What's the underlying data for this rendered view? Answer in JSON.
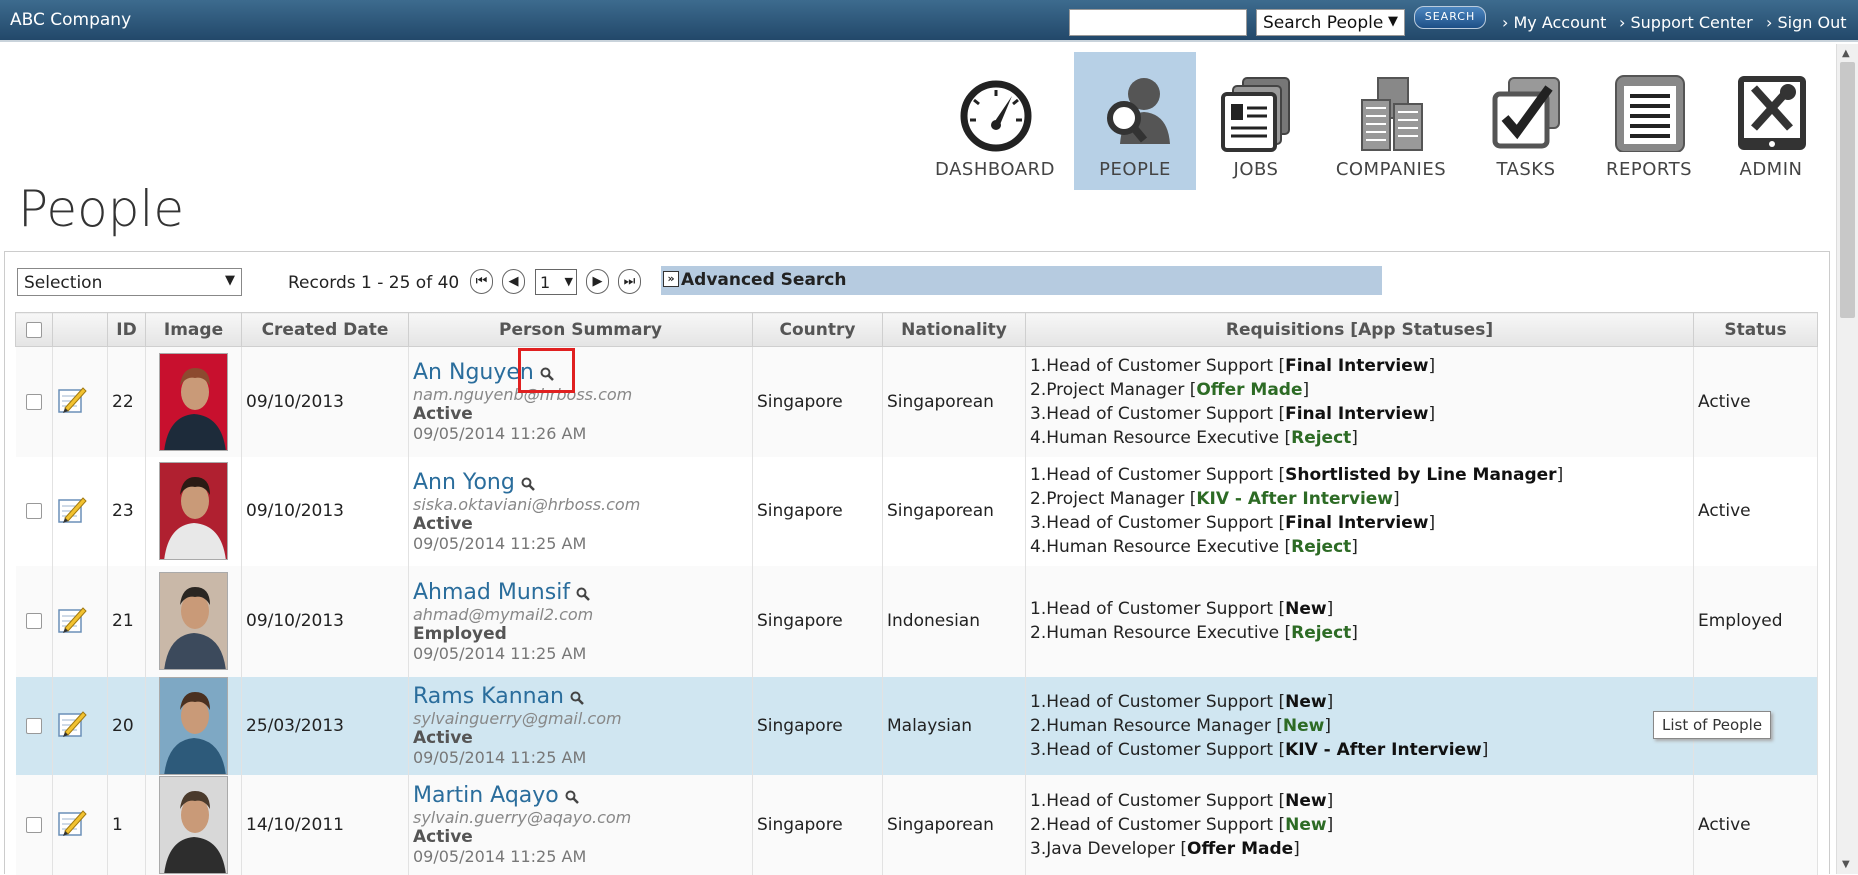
{
  "app": {
    "title": "ABC Company"
  },
  "topbar": {
    "search_placeholder": "",
    "search_type": "Search People",
    "search_button": "SEARCH",
    "links": [
      "› My Account",
      "› Support Center",
      "› Sign Out"
    ]
  },
  "nav": [
    {
      "label": "DASHBOARD",
      "icon": "dashboard-gauge-icon"
    },
    {
      "label": "PEOPLE",
      "icon": "people-icon",
      "active": true
    },
    {
      "label": "JOBS",
      "icon": "jobs-id-cards-icon"
    },
    {
      "label": "COMPANIES",
      "icon": "companies-buildings-icon"
    },
    {
      "label": "TASKS",
      "icon": "tasks-checkbox-icon"
    },
    {
      "label": "REPORTS",
      "icon": "reports-document-icon"
    },
    {
      "label": "ADMIN",
      "icon": "admin-tools-icon"
    }
  ],
  "page": {
    "title": "People"
  },
  "toolbar": {
    "selection": "Selection",
    "records": "Records 1 - 25 of 40",
    "page_number": "1",
    "advanced_search": "Advanced Search"
  },
  "table": {
    "columns": [
      "",
      "",
      "ID",
      "Image",
      "Created Date",
      "Person Summary",
      "Country",
      "Nationality",
      "Requisitions [App Statuses]",
      "Status"
    ],
    "rows": [
      {
        "id": "22",
        "created": "09/10/2013",
        "name": "An Nguyen",
        "email": "nam.nguyenb@hrboss.com",
        "person_status": "Active",
        "updated": "09/05/2014 11:26 AM",
        "country": "Singapore",
        "nationality": "Singaporean",
        "reqs": [
          {
            "text": "1.Head of Customer Support [",
            "status": "Final Interview"
          },
          {
            "text": "2.Project Manager [",
            "status": "Offer Made",
            "green": true
          },
          {
            "text": "3.Head of Customer Support [",
            "status": "Final Interview"
          },
          {
            "text": "4.Human Resource Executive [",
            "status": "Reject",
            "green": true
          }
        ],
        "status": "Active"
      },
      {
        "id": "23",
        "created": "09/10/2013",
        "name": "Ann Yong",
        "email": "siska.oktaviani@hrboss.com",
        "person_status": "Active",
        "updated": "09/05/2014 11:25 AM",
        "country": "Singapore",
        "nationality": "Singaporean",
        "reqs": [
          {
            "text": "1.Head of Customer Support [",
            "status": "Shortlisted by Line Manager"
          },
          {
            "text": "2.Project Manager [",
            "status": "KIV - After Interview",
            "green": true
          },
          {
            "text": "3.Head of Customer Support [",
            "status": "Final Interview"
          },
          {
            "text": "4.Human Resource Executive [",
            "status": "Reject",
            "green": true
          }
        ],
        "status": "Active"
      },
      {
        "id": "21",
        "created": "09/10/2013",
        "name": "Ahmad Munsif",
        "email": "ahmad@mymail2.com",
        "person_status": "Employed",
        "updated": "09/05/2014 11:25 AM",
        "country": "Singapore",
        "nationality": "Indonesian",
        "reqs": [
          {
            "text": "1.Head of Customer Support [",
            "status": "New"
          },
          {
            "text": "2.Human Resource Executive [",
            "status": "Reject",
            "green": true
          }
        ],
        "status": "Employed"
      },
      {
        "id": "20",
        "created": "25/03/2013",
        "name": "Rams Kannan",
        "email": "sylvainguerry@gmail.com",
        "person_status": "Active",
        "updated": "09/05/2014 11:25 AM",
        "country": "Singapore",
        "nationality": "Malaysian",
        "reqs": [
          {
            "text": "1.Head of Customer Support [",
            "status": "New"
          },
          {
            "text": "2.Human Resource Manager [",
            "status": "New",
            "green": true
          },
          {
            "text": "3.Head of Customer Support [",
            "status": "KIV - After Interview"
          }
        ],
        "status": ""
      },
      {
        "id": "1",
        "created": "14/10/2011",
        "name": "Martin Aqayo",
        "email": "sylvain.guerry@aqayo.com",
        "person_status": "Active",
        "updated": "09/05/2014 11:25 AM",
        "country": "Singapore",
        "nationality": "Singaporean",
        "reqs": [
          {
            "text": "1.Head of Customer Support [",
            "status": "New"
          },
          {
            "text": "2.Head of Customer Support [",
            "status": "New",
            "green": true
          },
          {
            "text": "3.Java Developer [",
            "status": "Offer Made"
          }
        ],
        "status": "Active"
      }
    ]
  },
  "tooltip": "List of People",
  "colors": {
    "topbar": "#22486a",
    "active_nav": "#b7d0e6",
    "selected_row": "#d0e6f1",
    "link": "#2a6d9c",
    "status_green": "#2d6b25",
    "highlight": "#e02020"
  }
}
